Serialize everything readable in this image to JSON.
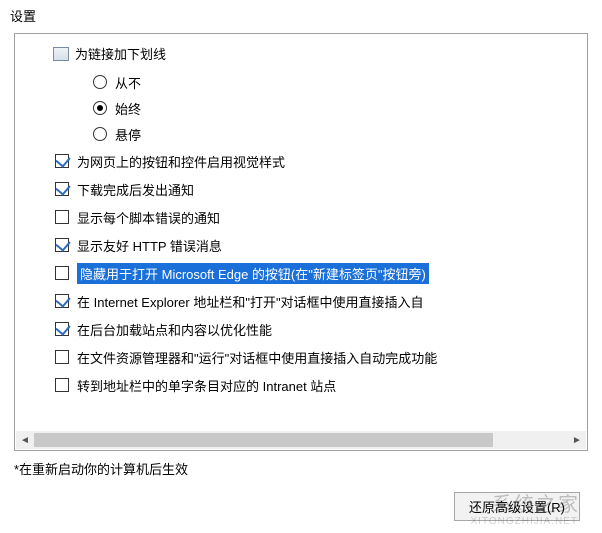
{
  "title": "设置",
  "group": {
    "label": "为链接加下划线",
    "radios": [
      {
        "label": "从不",
        "checked": false
      },
      {
        "label": "始终",
        "checked": true
      },
      {
        "label": "悬停",
        "checked": false
      }
    ]
  },
  "checkboxes": [
    {
      "label": "为网页上的按钮和控件启用视觉样式",
      "checked": true,
      "selected": false
    },
    {
      "label": "下载完成后发出通知",
      "checked": true,
      "selected": false
    },
    {
      "label": "显示每个脚本错误的通知",
      "checked": false,
      "selected": false
    },
    {
      "label": "显示友好 HTTP 错误消息",
      "checked": true,
      "selected": false
    },
    {
      "label": "隐藏用于打开 Microsoft Edge 的按钮(在\"新建标签页\"按钮旁)",
      "checked": false,
      "selected": true
    },
    {
      "label": "在 Internet Explorer 地址栏和\"打开\"对话框中使用直接插入自",
      "checked": true,
      "selected": false
    },
    {
      "label": "在后台加载站点和内容以优化性能",
      "checked": true,
      "selected": false
    },
    {
      "label": "在文件资源管理器和\"运行\"对话框中使用直接插入自动完成功能",
      "checked": false,
      "selected": false
    },
    {
      "label": "转到地址栏中的单字条目对应的 Intranet 站点",
      "checked": false,
      "selected": false
    }
  ],
  "note": "*在重新启动你的计算机后生效",
  "button": "还原高级设置(R)",
  "watermark": "系统之家",
  "watermark_sub": "XITONGZHIJIA.NET"
}
